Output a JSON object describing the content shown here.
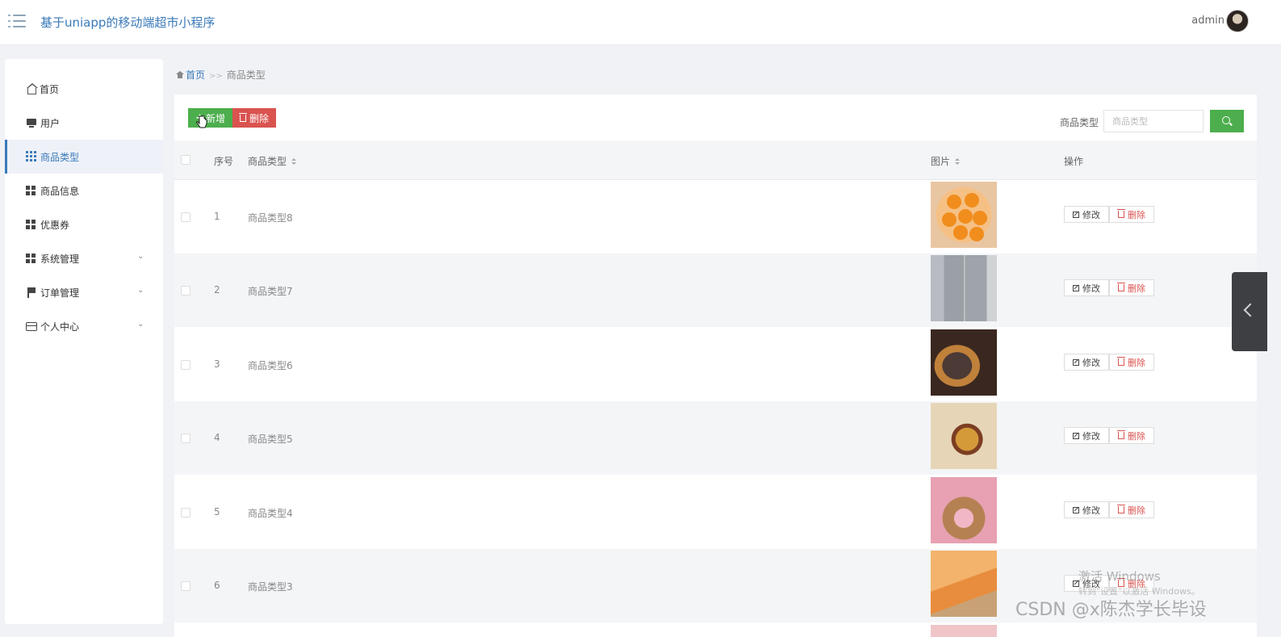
{
  "header": {
    "app_title": "基于uniapp的移动端超市小程序",
    "user_name": "admin"
  },
  "sidebar": {
    "items": [
      {
        "label": "首页",
        "icon": "home-icon",
        "active": false,
        "expandable": false
      },
      {
        "label": "用户",
        "icon": "monitor-icon",
        "active": false,
        "expandable": false
      },
      {
        "label": "商品类型",
        "icon": "grid-icon",
        "active": true,
        "expandable": false
      },
      {
        "label": "商品信息",
        "icon": "grid-icon",
        "active": false,
        "expandable": false
      },
      {
        "label": "优惠券",
        "icon": "grid-icon",
        "active": false,
        "expandable": false
      },
      {
        "label": "系统管理",
        "icon": "grid-icon",
        "active": false,
        "expandable": true
      },
      {
        "label": "订单管理",
        "icon": "flag-icon",
        "active": false,
        "expandable": true
      },
      {
        "label": "个人中心",
        "icon": "card-icon",
        "active": false,
        "expandable": true
      }
    ]
  },
  "breadcrumb": {
    "home": "首页",
    "separator": ">>",
    "current": "商品类型"
  },
  "toolbar": {
    "add_label": "新增",
    "delete_label": "删除",
    "search_label": "商品类型",
    "search_placeholder": "商品类型"
  },
  "table": {
    "headers": {
      "index": "序号",
      "type": "商品类型",
      "image": "图片",
      "actions": "操作"
    },
    "edit_label": "修改",
    "delete_label": "删除",
    "rows": [
      {
        "index": "1",
        "name": "商品类型8",
        "image": "oranges"
      },
      {
        "index": "2",
        "name": "商品类型7",
        "image": "fridge"
      },
      {
        "index": "3",
        "name": "商品类型6",
        "image": "mooncake"
      },
      {
        "index": "4",
        "name": "商品类型5",
        "image": "burger-set"
      },
      {
        "index": "5",
        "name": "商品类型4",
        "image": "candy-box"
      },
      {
        "index": "6",
        "name": "商品类型3",
        "image": "melon"
      }
    ]
  },
  "overlays": {
    "activate_windows": "激活 Windows",
    "activate_windows_sub": "转到\"设置\"以激活 Windows。",
    "csdn_watermark": "CSDN @x陈杰学长毕设"
  },
  "colors": {
    "accent": "#3a7ab8",
    "success": "#4cae4c",
    "danger": "#d9534f",
    "page_bg": "#f0f2f6"
  }
}
